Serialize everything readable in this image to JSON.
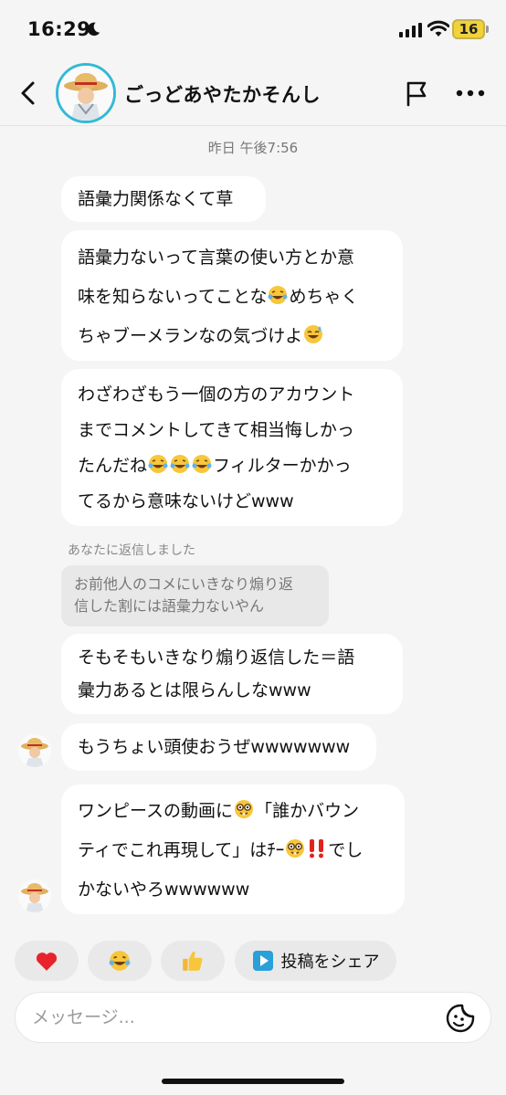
{
  "status_bar": {
    "time": "16:29",
    "battery": "16"
  },
  "header": {
    "name": "ごっどあやたかそんし"
  },
  "thread": {
    "timestamp": "昨日 午後7:56",
    "msg1": "語彙力関係なくて草",
    "msg2_l1": "語彙力ないって言葉の使い方とか意",
    "msg2_l2a": "味を知らないってことな",
    "msg2_l2b": "めちゃく",
    "msg2_l3": "ちゃブーメランなの気づけよ",
    "msg3_l1": "わざわざもう一個の方のアカウント",
    "msg3_l2": "までコメントしてきて相当悔しかっ",
    "msg3_l3a": "たんだね",
    "msg3_l3b": "フィルターかかっ",
    "msg3_l4": "てるから意味ないけどwww",
    "reply_label": "あなたに返信しました",
    "reply_quote_l1": "お前他人のコメにいきなり煽り返",
    "reply_quote_l2": "信した割には語彙力ないやん",
    "msg4_l1": "そもそもいきなり煽り返信した＝語",
    "msg4_l2": "彙力あるとは限らんしなwww",
    "msg5": "もうちょい頭使おうぜwwwwwww",
    "msg6_l1a": "ワンピースの動画に",
    "msg6_l1b": "「誰かバウン",
    "msg6_l2a": "ティでこれ再現して」はﾁｰ",
    "msg6_l2b": "でし",
    "msg6_l3": "かないやろwwwwww"
  },
  "quick_reactions": {
    "heart": "❤️",
    "laugh": "😂",
    "thumbs": "👍",
    "share_label": "投稿をシェア"
  },
  "composer": {
    "placeholder": "メッセージ..."
  },
  "colors": {
    "accent_ring": "#35b9d6",
    "background": "#f5f5f5",
    "bubble": "#ffffff",
    "share_icon": "#2a9fd8"
  }
}
